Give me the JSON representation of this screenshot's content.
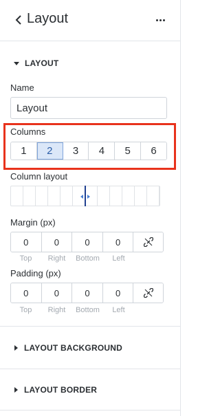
{
  "header": {
    "title": "Layout",
    "back_icon": "chevron-left-icon",
    "more_icon": "ellipsis-icon"
  },
  "layout_section": {
    "label": "LAYOUT",
    "expanded": true,
    "name": {
      "label": "Name",
      "value": "Layout"
    },
    "columns": {
      "label": "Columns",
      "options": [
        "1",
        "2",
        "3",
        "4",
        "5",
        "6"
      ],
      "selected": "2"
    },
    "column_layout": {
      "label": "Column layout",
      "cell_count": 12
    },
    "margin": {
      "label": "Margin (px)",
      "top": "0",
      "right": "0",
      "bottom": "0",
      "left": "0",
      "captions": {
        "top": "Top",
        "right": "Right",
        "bottom": "Bottom",
        "left": "Left"
      },
      "link_icon": "unlink-icon"
    },
    "padding": {
      "label": "Padding (px)",
      "top": "0",
      "right": "0",
      "bottom": "0",
      "left": "0",
      "captions": {
        "top": "Top",
        "right": "Right",
        "bottom": "Bottom",
        "left": "Left"
      },
      "link_icon": "unlink-icon"
    }
  },
  "layout_background_section": {
    "label": "LAYOUT BACKGROUND",
    "expanded": false
  },
  "layout_border_section": {
    "label": "LAYOUT BORDER",
    "expanded": false
  },
  "colors": {
    "highlight": "#e8321c",
    "selected_bg": "#dbe7f8",
    "selected_text": "#2b5ea7",
    "splitter": "#1f3f8f"
  }
}
